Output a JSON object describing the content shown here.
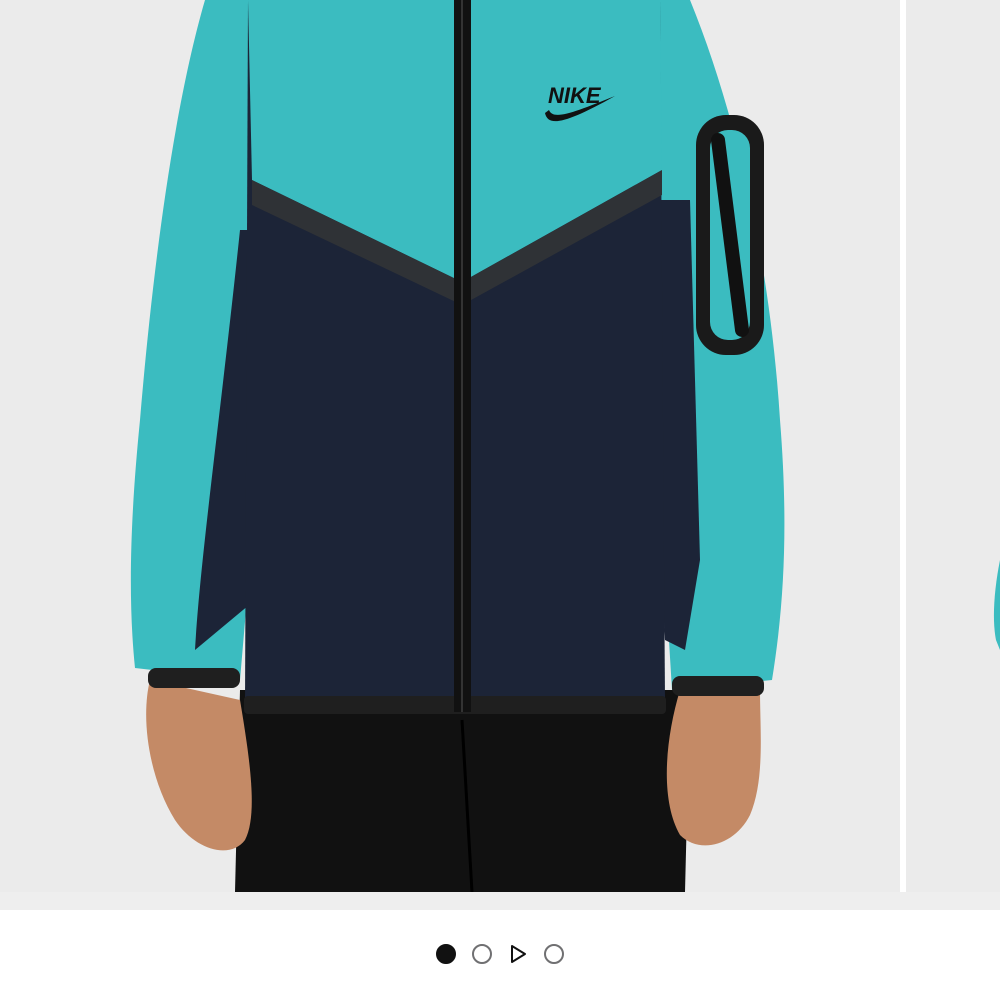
{
  "product_image": {
    "logo_text": "NIKE",
    "colors": {
      "turquoise": "#3bbcc0",
      "navy": "#1c2437",
      "trim": "#2b2b2b",
      "pants": "#111111",
      "skin": "#c48a66",
      "background": "#ebebeb"
    }
  },
  "pager": {
    "items": [
      {
        "type": "image",
        "state": "active"
      },
      {
        "type": "image",
        "state": "inactive"
      },
      {
        "type": "video",
        "icon": "play-icon"
      },
      {
        "type": "image",
        "state": "inactive"
      }
    ],
    "active_index": 0
  }
}
